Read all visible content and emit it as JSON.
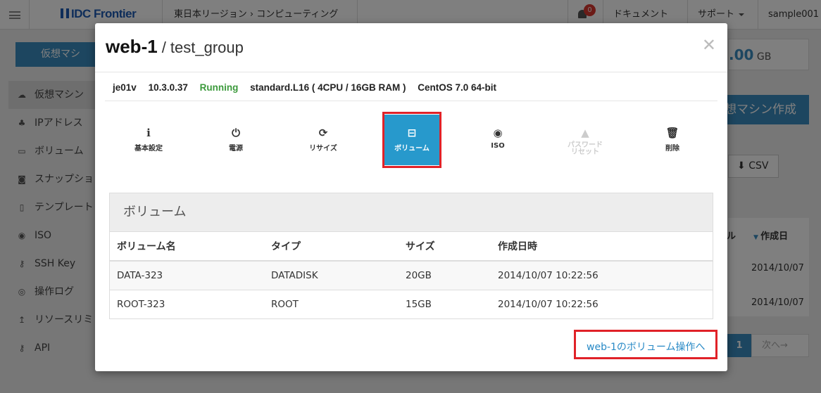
{
  "topbar": {
    "logo": "IDC Frontier",
    "breadcrumb": "東日本リージョン ›  コンピューティング",
    "notification_count": "0",
    "nav_docs": "ドキュメント",
    "nav_support": "サポート",
    "nav_user": "sample001"
  },
  "background": {
    "create_vm_short": "仮想マシ",
    "storage_value": ".00",
    "storage_unit": "GB",
    "create_vm_button": "想マシン作成",
    "csv_button": "CSV",
    "col_header_partial": "ル",
    "col_header_date": "作成日",
    "row1_date": "2014/10/07",
    "row2_date": "2014/10/07",
    "page_current": "1",
    "page_next": "次へ→"
  },
  "sidebar": {
    "items": [
      {
        "label": "仮想マシン",
        "icon": "cloud-icon"
      },
      {
        "label": "IPアドレス",
        "icon": "network-icon"
      },
      {
        "label": "ボリューム",
        "icon": "drive-icon"
      },
      {
        "label": "スナップショ",
        "icon": "camera-icon"
      },
      {
        "label": "テンプレート",
        "icon": "file-icon"
      },
      {
        "label": "ISO",
        "icon": "disc-icon"
      },
      {
        "label": "SSH Key",
        "icon": "key-icon"
      },
      {
        "label": "操作ログ",
        "icon": "eye-icon"
      },
      {
        "label": "リソースリミ",
        "icon": "arrow-up-icon"
      },
      {
        "label": "API",
        "icon": "key-icon"
      }
    ]
  },
  "modal": {
    "title": "web-1",
    "subtitle": "/ test_group",
    "info": {
      "zone": "je01v",
      "ip": "10.3.0.37",
      "status": "Running",
      "plan": "standard.L16 ( 4CPU / 16GB RAM )",
      "os": "CentOS 7.0 64-bit"
    },
    "actions": [
      {
        "label": "基本設定",
        "icon": "info-icon"
      },
      {
        "label": "電源",
        "icon": "power-icon"
      },
      {
        "label": "リサイズ",
        "icon": "refresh-icon"
      },
      {
        "label": "ボリューム",
        "icon": "drive-icon"
      },
      {
        "label": "ISO",
        "icon": "disc-icon"
      },
      {
        "label": "パスワード\nリセット",
        "icon": "lock-icon"
      },
      {
        "label": "削除",
        "icon": "trash-icon"
      }
    ],
    "panel_title": "ボリューム",
    "table": {
      "headers": [
        "ボリューム名",
        "タイプ",
        "サイズ",
        "作成日時"
      ],
      "rows": [
        [
          "DATA-323",
          "DATADISK",
          "20GB",
          "2014/10/07 10:22:56"
        ],
        [
          "ROOT-323",
          "ROOT",
          "15GB",
          "2014/10/07 10:22:56"
        ]
      ]
    },
    "volume_link": "web-1のボリューム操作へ"
  },
  "colors": {
    "accent": "#2799cc",
    "highlight": "#e02228",
    "running": "#3c9a3c"
  }
}
